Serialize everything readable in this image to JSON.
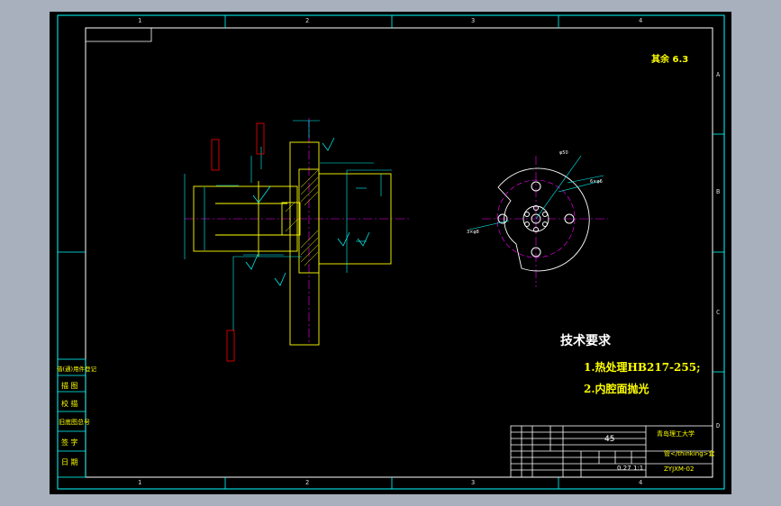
{
  "zones": {
    "columns": [
      "1",
      "2",
      "3",
      "4"
    ],
    "rows": [
      "A",
      "B",
      "C",
      "D"
    ]
  },
  "roughness_note": "其余 6.3",
  "technical_requirements": {
    "title": "技术要求",
    "items": [
      "1.热处理HB217-255;",
      "2.内腔面抛光"
    ]
  },
  "title_block": {
    "material": "45",
    "school": "青岛理工大学",
    "part_name": "管</thinking>套",
    "drawing_no": "ZYJXM-02",
    "scale": "1:1",
    "mass": "0.27"
  },
  "side_panel": [
    "借(通)用件登记",
    "描 图",
    "校 描",
    "旧底图总号",
    "签 字",
    "日 期"
  ],
  "colors": {
    "background": "#000000",
    "frame": "#00ffff",
    "part_outline": "#ffff00",
    "centerline": "#ff00ff",
    "dimension": "#00ffff",
    "annotation": "#ff0000"
  }
}
